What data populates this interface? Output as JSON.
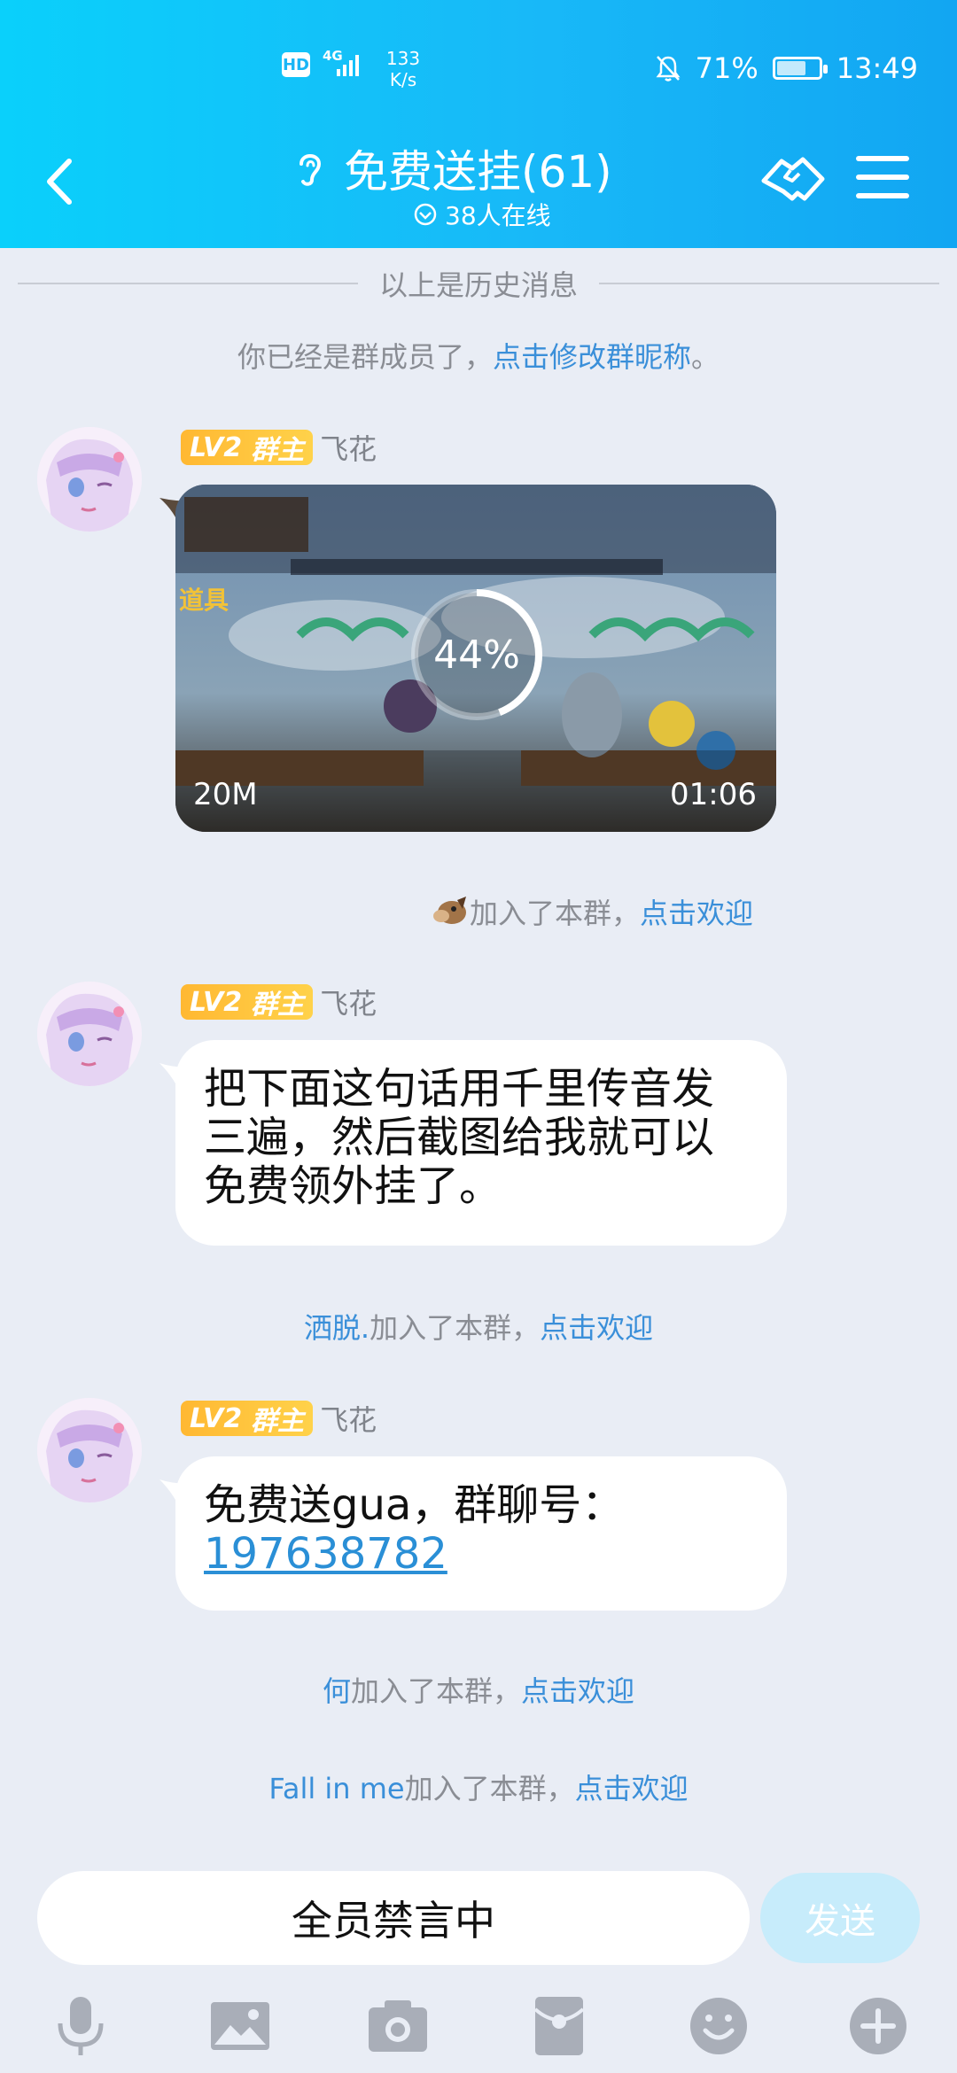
{
  "status_bar": {
    "hd": "HD",
    "net_type": "4G",
    "speed_value": "133",
    "speed_unit": "K/s",
    "battery": "71%",
    "battery_level": 0.71,
    "time": "13:49"
  },
  "header": {
    "title": "免费送挂(61)",
    "online": "38人在线"
  },
  "history_divider": "以上是历史消息",
  "member_notice": {
    "text": "你已经是群成员了，",
    "link": "点击修改群昵称",
    "end": "。"
  },
  "messages": [
    {
      "level": "LV2",
      "role": "群主",
      "sender": "飞花",
      "type": "video",
      "progress": "44%",
      "progress_value": 0.44,
      "size": "20M",
      "duration": "01:06"
    },
    {
      "level": "LV2",
      "role": "群主",
      "sender": "飞花",
      "type": "text",
      "lines": [
        "把下面这句话用千里传音发",
        "三遍，然后截图给我就可以",
        "免费领外挂了。"
      ]
    },
    {
      "level": "LV2",
      "role": "群主",
      "sender": "飞花",
      "type": "text",
      "line1": "免费送gua，群聊号：",
      "number": "197638782"
    }
  ],
  "joins": [
    {
      "name": "",
      "text": "加入了本群，",
      "link": "点击欢迎"
    },
    {
      "name": "洒脱.",
      "text": "加入了本群，",
      "link": "点击欢迎"
    },
    {
      "name": "何",
      "text": "加入了本群，",
      "link": "点击欢迎"
    },
    {
      "name": "Fall in me",
      "text": "加入了本群，",
      "link": "点击欢迎"
    }
  ],
  "input": {
    "placeholder": "全员禁言中",
    "send": "发送"
  },
  "toolbar": [
    "mic-icon",
    "image-icon",
    "camera-icon",
    "red-packet-icon",
    "emoji-icon",
    "plus-icon"
  ],
  "colors": {
    "header_start": "#0ad0fb",
    "header_end": "#12a6f2",
    "link": "#3a8fd9",
    "badge": "#ffc23d",
    "background": "#e9edf5"
  }
}
